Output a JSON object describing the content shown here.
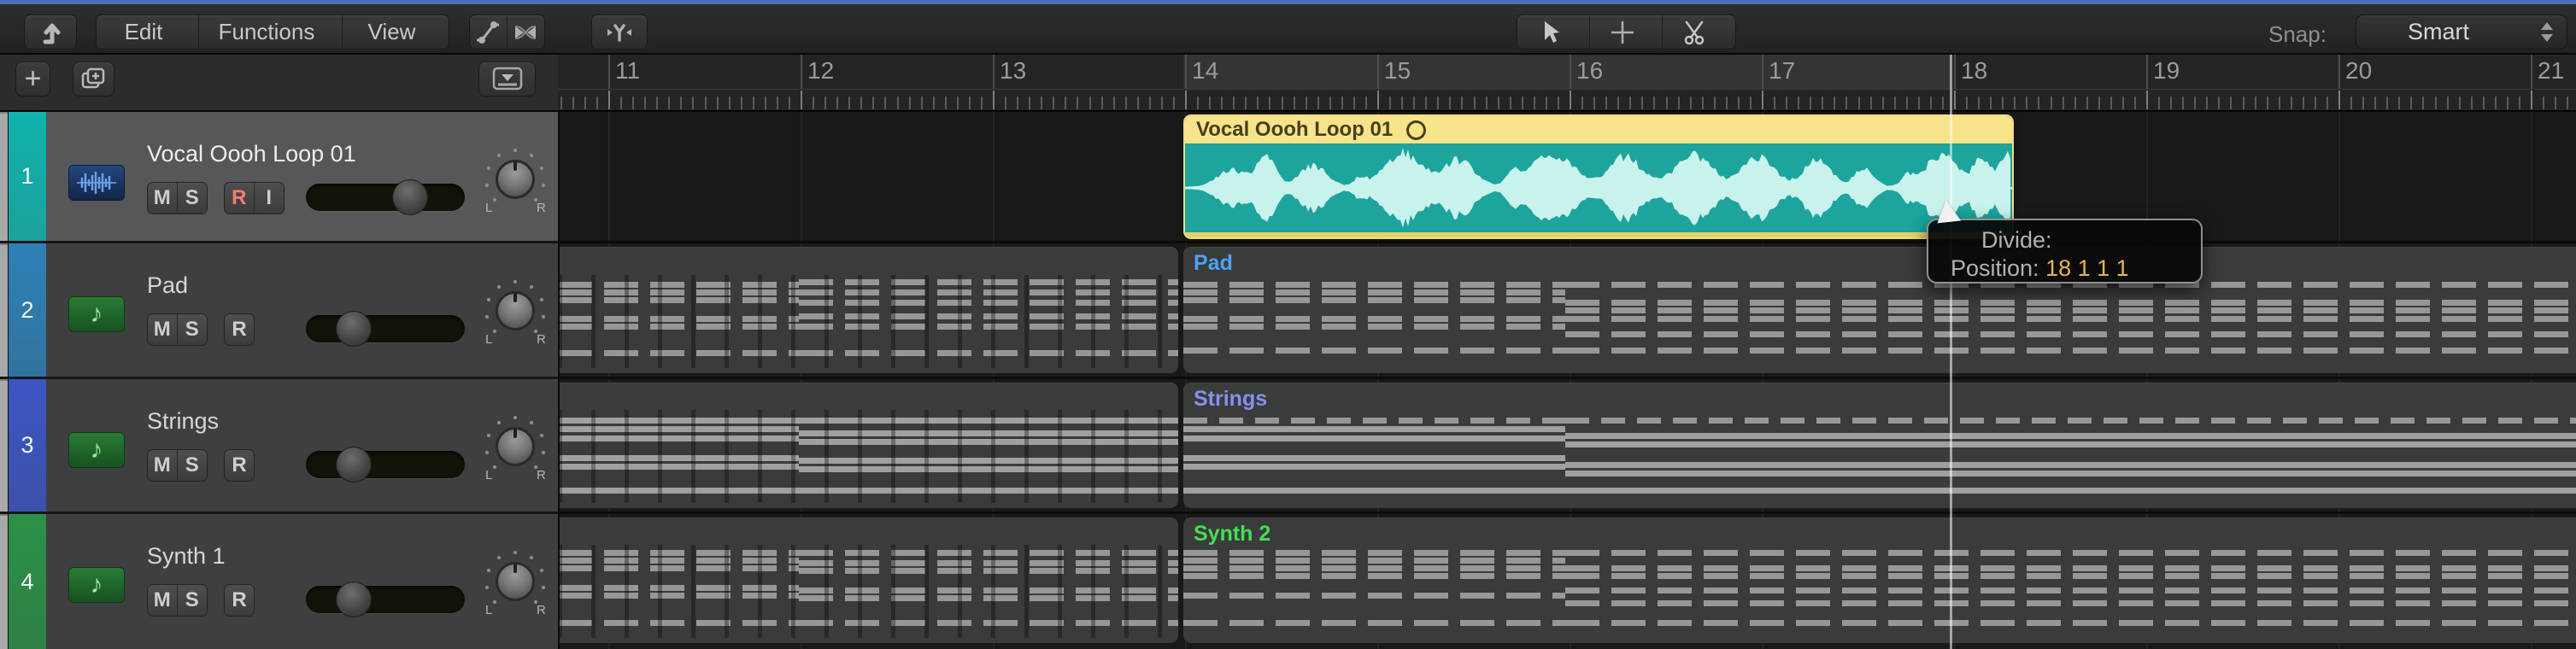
{
  "toolbar": {
    "menus": [
      {
        "label": "Edit"
      },
      {
        "label": "Functions"
      },
      {
        "label": "View"
      }
    ],
    "tools": [
      "pointer-tool",
      "crosshair-tool",
      "scissors-tool"
    ],
    "icon_buttons": [
      "back-arrow",
      "automation",
      "flex",
      "catch-funnel"
    ],
    "snap": {
      "label": "Snap:",
      "value": "Smart"
    }
  },
  "subbar": {
    "buttons": [
      "add-track",
      "duplicate-track",
      "track-options"
    ]
  },
  "ruler": {
    "bars": [
      11,
      12,
      13,
      14,
      15,
      16,
      17,
      18,
      19,
      20,
      21
    ]
  },
  "tracks": [
    {
      "num": "1",
      "name": "Vocal Oooh Loop 01",
      "type": "audio",
      "color": "#0fb3ad",
      "buttons": [
        "M",
        "S",
        "R",
        "I"
      ],
      "r_color": "#f27e74",
      "slider_pos": 0.7,
      "selected": true,
      "pan": {
        "left": "L",
        "right": "R"
      }
    },
    {
      "num": "2",
      "name": "Pad",
      "type": "midi",
      "color": "#2e80b6",
      "buttons": [
        "M",
        "S",
        "R"
      ],
      "r_color": "#cecece",
      "slider_pos": 0.24,
      "selected": false,
      "pan": {
        "left": "L",
        "right": "R"
      }
    },
    {
      "num": "3",
      "name": "Strings",
      "type": "midi",
      "color": "#3c55c4",
      "buttons": [
        "M",
        "S",
        "R"
      ],
      "r_color": "#cecece",
      "slider_pos": 0.24,
      "selected": false,
      "pan": {
        "left": "L",
        "right": "R"
      }
    },
    {
      "num": "4",
      "name": "Synth 1",
      "type": "midi",
      "color": "#2b9146",
      "buttons": [
        "M",
        "S",
        "R"
      ],
      "r_color": "#cecece",
      "slider_pos": 0.24,
      "selected": false,
      "pan": {
        "left": "L",
        "right": "R"
      }
    }
  ],
  "audio_region": {
    "name": "Vocal Oooh Loop 01",
    "header_color": "#f7e38a",
    "body_color": "#1ca49d",
    "wave_color": "#c9f2ec",
    "phrases": [
      [
        55,
        22,
        0.5
      ],
      [
        95,
        16,
        0.8
      ],
      [
        150,
        22,
        0.6
      ],
      [
        205,
        10,
        0.25
      ],
      [
        255,
        30,
        0.95
      ],
      [
        320,
        26,
        0.75
      ],
      [
        385,
        12,
        0.3
      ],
      [
        430,
        34,
        0.95
      ],
      [
        515,
        26,
        0.85
      ],
      [
        595,
        30,
        0.9
      ],
      [
        672,
        26,
        0.85
      ],
      [
        740,
        22,
        0.75
      ],
      [
        795,
        16,
        0.5
      ],
      [
        845,
        10,
        0.3
      ],
      [
        885,
        26,
        0.9
      ],
      [
        933,
        14,
        0.8
      ],
      [
        962,
        12,
        0.95
      ]
    ]
  },
  "midi_regions": [
    {
      "track": 2,
      "side": "left",
      "label": null,
      "stripes": true,
      "split": 282,
      "rowsA": [
        [
          0.3,
          "d"
        ],
        [
          0.36,
          "d"
        ],
        [
          0.42,
          "d"
        ],
        [
          0.57,
          "d"
        ],
        [
          0.63,
          "d"
        ],
        [
          0.84,
          "d"
        ]
      ],
      "rowsB": [
        [
          0.28,
          "d"
        ],
        [
          0.36,
          "d"
        ],
        [
          0.44,
          "d"
        ],
        [
          0.55,
          "d"
        ],
        [
          0.63,
          "d"
        ],
        [
          0.84,
          "d"
        ]
      ]
    },
    {
      "track": 3,
      "side": "left",
      "label": null,
      "stripes": true,
      "split": 282,
      "rowsA": [
        [
          0.3,
          "s"
        ],
        [
          0.37,
          "s"
        ],
        [
          0.44,
          "s"
        ],
        [
          0.6,
          "s"
        ],
        [
          0.67,
          "s"
        ],
        [
          0.86,
          "s"
        ]
      ],
      "rowsB": [
        [
          0.3,
          "s"
        ],
        [
          0.4,
          "s"
        ],
        [
          0.47,
          "s"
        ],
        [
          0.62,
          "s"
        ],
        [
          0.69,
          "s"
        ],
        [
          0.86,
          "s"
        ]
      ]
    },
    {
      "track": 4,
      "side": "left",
      "label": null,
      "stripes": true,
      "split": 282,
      "rowsA": [
        [
          0.28,
          "d"
        ],
        [
          0.34,
          "d"
        ],
        [
          0.4,
          "d"
        ],
        [
          0.56,
          "d"
        ],
        [
          0.62,
          "d"
        ],
        [
          0.84,
          "d"
        ]
      ],
      "rowsB": [
        [
          0.28,
          "d"
        ],
        [
          0.36,
          "d"
        ],
        [
          0.42,
          "d"
        ],
        [
          0.58,
          "d"
        ],
        [
          0.64,
          "d"
        ],
        [
          0.84,
          "d"
        ]
      ]
    },
    {
      "track": 2,
      "side": "right",
      "label": "Pad",
      "label_color": "#4da3f5",
      "stripes": false,
      "split": 447,
      "rowsA": [
        [
          0.3,
          "d"
        ],
        [
          0.36,
          "d"
        ],
        [
          0.42,
          "d"
        ],
        [
          0.565,
          "d"
        ],
        [
          0.625,
          "d"
        ],
        [
          0.82,
          "d"
        ]
      ],
      "rowsB": [
        [
          0.3,
          "d"
        ],
        [
          0.44,
          "d"
        ],
        [
          0.5,
          "d"
        ],
        [
          0.565,
          "d"
        ],
        [
          0.69,
          "d"
        ],
        [
          0.82,
          "d"
        ]
      ]
    },
    {
      "track": 3,
      "side": "right",
      "label": "Strings",
      "label_color": "#8590ee",
      "stripes": false,
      "split": 447,
      "rowsA": [
        [
          0.3,
          "dd"
        ],
        [
          0.37,
          "s"
        ],
        [
          0.44,
          "s"
        ],
        [
          0.6,
          "s"
        ],
        [
          0.67,
          "s"
        ],
        [
          0.86,
          "s"
        ]
      ],
      "rowsB": [
        [
          0.3,
          "dd"
        ],
        [
          0.42,
          "s"
        ],
        [
          0.49,
          "s"
        ],
        [
          0.65,
          "s"
        ],
        [
          0.72,
          "s"
        ],
        [
          0.86,
          "s"
        ]
      ]
    },
    {
      "track": 4,
      "side": "right",
      "label": "Synth 2",
      "label_color": "#44dd55",
      "stripes": false,
      "split": 447,
      "rowsA": [
        [
          0.28,
          "d"
        ],
        [
          0.34,
          "d"
        ],
        [
          0.4,
          "d"
        ],
        [
          0.46,
          "d"
        ],
        [
          0.62,
          "d"
        ],
        [
          0.84,
          "d"
        ]
      ],
      "rowsB": [
        [
          0.28,
          "d"
        ],
        [
          0.4,
          "d"
        ],
        [
          0.46,
          "d"
        ],
        [
          0.58,
          "d"
        ],
        [
          0.68,
          "d"
        ],
        [
          0.84,
          "d"
        ]
      ]
    }
  ],
  "tooltip": {
    "line1": "Divide:",
    "line2_label": "Position: ",
    "line2_value": "18 1 1 1",
    "value_color": "#e2b84e"
  }
}
